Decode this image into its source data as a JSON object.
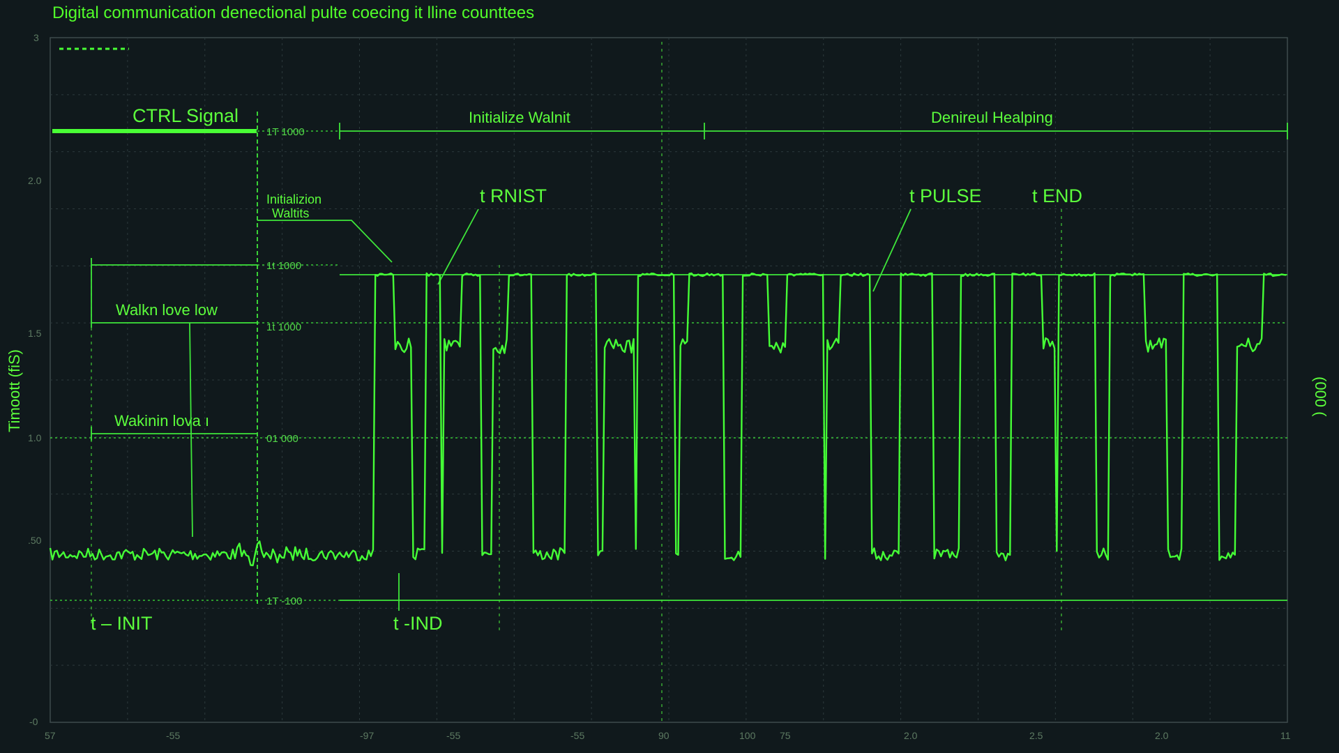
{
  "chart_data": {
    "type": "line",
    "title": "Digital communication denectional pulte coecing it lline counttees",
    "ylabel": "Timoott (fiS)",
    "xlabel": "",
    "right_axis_label": "(000 (",
    "y_ticks": [
      "3",
      "2.0",
      "1.5",
      "1.0",
      ".50",
      "-0"
    ],
    "x_ticks": [
      "57",
      "-55",
      "-97",
      "-55",
      "-55",
      "90",
      "100",
      "75",
      "2.0",
      "2.5",
      "2.0",
      "11"
    ],
    "level_labels": [
      "1T 1000",
      "1t 1000",
      "1t 1000",
      "01 000",
      "1T -100"
    ],
    "legend_text": "- - - - -",
    "annotations": {
      "ctrl_signal": "CTRL Signal",
      "initialize_wait": "Initialize Walnit",
      "denied_helping": "Denireul Healping",
      "init_waits_1": "Initializion",
      "init_waits_2": "Waltits",
      "t_rnist": "t RNIST",
      "t_pulse": "t PULSE",
      "t_end": "t END",
      "walkn_low": "Walkn love low",
      "wakinin_low": "Wakinin lova ı",
      "t_init": "t – INIT",
      "t_ind": "t -IND"
    },
    "series": [
      {
        "color": "#45ff36",
        "x_start": 0.0,
        "x_end": 1.0,
        "baseline": 0.45,
        "high": 1.75,
        "mid": 1.55,
        "pulse_centers": [
          0.27,
          0.31,
          0.34,
          0.38,
          0.43,
          0.49,
          0.53,
          0.57,
          0.61,
          0.65,
          0.7,
          0.75,
          0.79,
          0.83,
          0.87,
          0.93,
          0.99
        ],
        "pulse_widths": [
          0.015,
          0.012,
          0.016,
          0.02,
          0.025,
          0.03,
          0.028,
          0.022,
          0.03,
          0.025,
          0.028,
          0.03,
          0.025,
          0.03,
          0.028,
          0.03,
          0.02
        ],
        "mid_bumps": [
          0.28,
          0.33,
          0.37,
          0.46,
          0.52,
          0.59,
          0.64,
          0.7,
          0.75,
          0.8,
          0.89,
          0.97
        ]
      }
    ]
  }
}
